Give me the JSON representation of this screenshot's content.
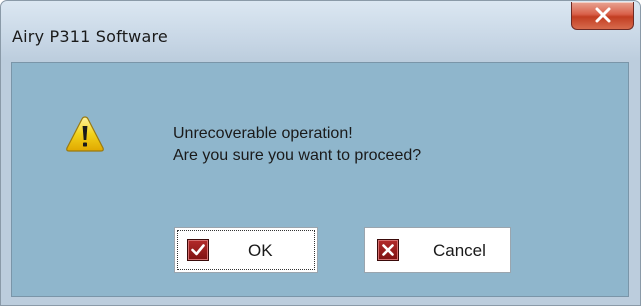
{
  "window": {
    "title": "Airy P311 Software"
  },
  "dialog": {
    "message_line1": "Unrecoverable operation!",
    "message_line2": "Are you sure you want to proceed?",
    "icon": "warning-icon"
  },
  "buttons": {
    "ok_label": "OK",
    "ok_icon": "check-icon",
    "cancel_label": "Cancel",
    "cancel_icon": "x-icon"
  },
  "colors": {
    "client_background": "#8fb6cc",
    "close_button": "#c23e22",
    "button_icon": "#9a1c1c",
    "warning_yellow": "#f2d21b"
  }
}
